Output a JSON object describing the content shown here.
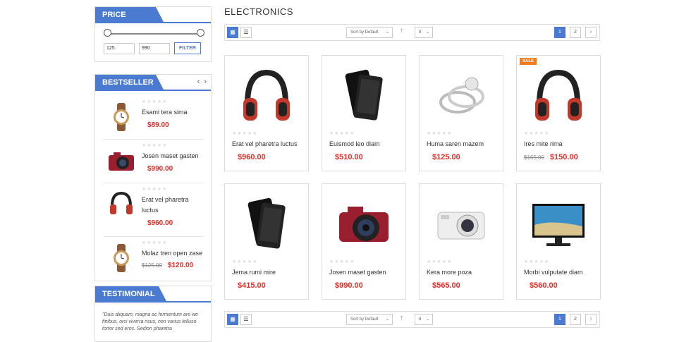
{
  "sidebar": {
    "price": {
      "title": "PRICE",
      "min": "125",
      "max": "990",
      "filter_label": "FILTER"
    },
    "bestseller": {
      "title": "BESTSELLER",
      "items": [
        {
          "name": "Esami tera sima",
          "price": "$89.00",
          "old": "",
          "icon": "watch-icon"
        },
        {
          "name": "Josen maset gasten",
          "price": "$990.00",
          "old": "",
          "icon": "camera-icon"
        },
        {
          "name": "Erat vel pharetra luctus",
          "price": "$960.00",
          "old": "",
          "icon": "headphones-icon"
        },
        {
          "name": "Molaz tren open zase",
          "price": "$120.00",
          "old": "$125.00",
          "icon": "watch-icon"
        }
      ]
    },
    "testimonial": {
      "title": "TESTIMONIAL",
      "text": "\"Duis aliquam, magna ac fermentum are we finibus, orci viverra risus, non varius telluso tortor sed eros. Sedion pharetra"
    }
  },
  "main": {
    "title": "ELECTRONICS",
    "toolbar": {
      "sort": "Sort by Default",
      "limit": "8",
      "pages": [
        "1",
        "2"
      ],
      "next": "›"
    },
    "products": [
      {
        "name": "Erat vel pharetra luctus",
        "price": "$960.00",
        "old": "",
        "sale": "",
        "icon": "headphones-icon"
      },
      {
        "name": "Euismod leo diam",
        "price": "$510.00",
        "old": "",
        "sale": "",
        "icon": "smartphone-icon"
      },
      {
        "name": "Huma saren mazem",
        "price": "$125.00",
        "old": "",
        "sale": "",
        "icon": "ring-icon"
      },
      {
        "name": "Ires mite rima",
        "price": "$150.00",
        "old": "$165.00",
        "sale": "SALE",
        "icon": "headphones-icon"
      },
      {
        "name": "Jema rumi mire",
        "price": "$415.00",
        "old": "",
        "sale": "",
        "icon": "smartphone-icon"
      },
      {
        "name": "Josen maset gasten",
        "price": "$990.00",
        "old": "",
        "sale": "",
        "icon": "camera-icon"
      },
      {
        "name": "Kera more poza",
        "price": "$565.00",
        "old": "",
        "sale": "",
        "icon": "compact-camera-icon"
      },
      {
        "name": "Morbi vulputate diam",
        "price": "$560.00",
        "old": "",
        "sale": "",
        "icon": "monitor-icon"
      }
    ]
  },
  "colors": {
    "accent": "#4a7bd0",
    "price": "#e0302b",
    "sale": "#f07c1e"
  }
}
